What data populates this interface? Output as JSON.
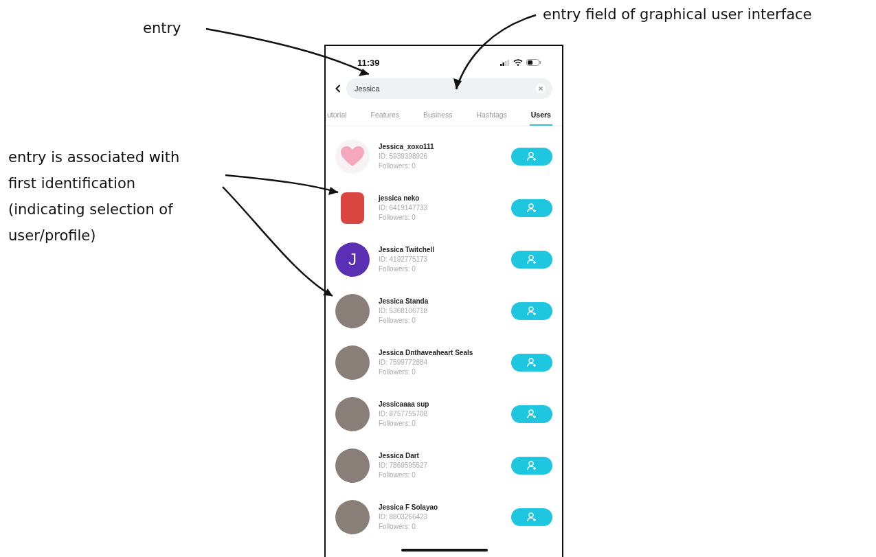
{
  "annotations": [
    {
      "kind": "entry",
      "text": "entry"
    },
    {
      "kind": "field",
      "text": "entry field of graphical user interface"
    },
    {
      "kind": "association",
      "text": "entry is associated with first identification (indicating selection of user/profile)"
    }
  ],
  "status_bar": {
    "time": "11:39"
  },
  "search": {
    "value": "Jessica"
  },
  "tabs": [
    {
      "label": "utorial",
      "selected": false
    },
    {
      "label": "Features",
      "selected": false
    },
    {
      "label": "Business",
      "selected": false
    },
    {
      "label": "Hashtags",
      "selected": false
    },
    {
      "label": "Users",
      "selected": true
    }
  ],
  "users": [
    {
      "name": "Jessica_xoxo111",
      "id": "ID: 5939398926",
      "followers": "Followers: 0",
      "kind": "heart"
    },
    {
      "name": "jessica neko",
      "id": "ID: 6419147733",
      "followers": "Followers: 0",
      "kind": "sticker"
    },
    {
      "name": "Jessica Twitchell",
      "id": "ID: 4192775173",
      "followers": "Followers: 0",
      "kind": "letter",
      "letter": "J",
      "color": "#5a2fb3"
    },
    {
      "name": "Jessica Standa",
      "id": "ID: 5368106718",
      "followers": "Followers: 0",
      "kind": "photo"
    },
    {
      "name": "Jessica Dnthaveaheart Seals",
      "id": "ID: 7599772884",
      "followers": "Followers: 0",
      "kind": "photo"
    },
    {
      "name": "Jessicaaaa  sup",
      "id": "ID: 8757755708",
      "followers": "Followers: 0",
      "kind": "photo"
    },
    {
      "name": "Jessica Dart",
      "id": "ID: 7869595527",
      "followers": "Followers: 0",
      "kind": "photo"
    },
    {
      "name": "Jessica F Solayao",
      "id": "ID: 8803266423",
      "followers": "Followers: 0",
      "kind": "photo"
    }
  ]
}
